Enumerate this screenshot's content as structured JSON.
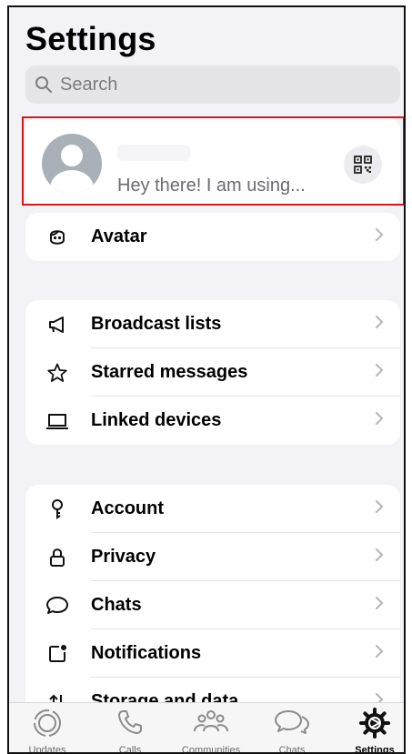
{
  "header": {
    "title": "Settings"
  },
  "search": {
    "placeholder": "Search"
  },
  "profile": {
    "status": "Hey there! I am using..."
  },
  "avatar_row": {
    "label": "Avatar"
  },
  "group2": [
    {
      "label": "Broadcast lists",
      "icon": "megaphone-icon"
    },
    {
      "label": "Starred messages",
      "icon": "star-icon"
    },
    {
      "label": "Linked devices",
      "icon": "laptop-icon"
    }
  ],
  "group3": [
    {
      "label": "Account",
      "icon": "key-icon"
    },
    {
      "label": "Privacy",
      "icon": "lock-icon"
    },
    {
      "label": "Chats",
      "icon": "chat-bubble-icon"
    },
    {
      "label": "Notifications",
      "icon": "notification-icon"
    },
    {
      "label": "Storage and data",
      "icon": "storage-arrows-icon"
    }
  ],
  "tabs": [
    {
      "label": "Updates",
      "icon": "updates-icon"
    },
    {
      "label": "Calls",
      "icon": "phone-icon"
    },
    {
      "label": "Communities",
      "icon": "communities-icon"
    },
    {
      "label": "Chats",
      "icon": "chats-icon"
    },
    {
      "label": "Settings",
      "icon": "settings-gear-icon",
      "active": true
    }
  ],
  "colors": {
    "highlight": "#d9151b",
    "background": "#f2f2f7",
    "card": "#ffffff"
  }
}
